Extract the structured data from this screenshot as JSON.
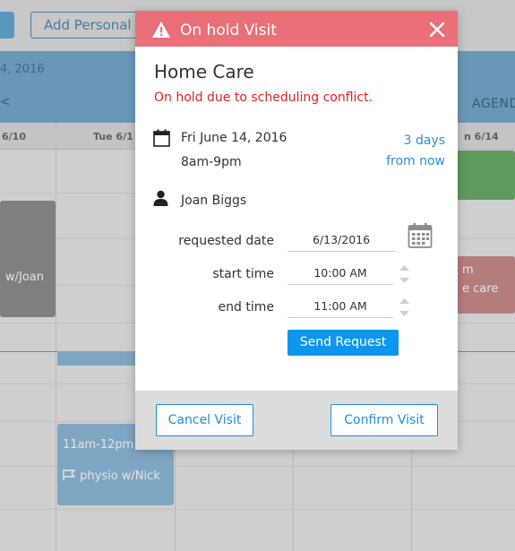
{
  "background": {
    "add_button_label": "Add Personal E",
    "date_label": "4, 2016",
    "nav_left": "<",
    "agenda_label": "AGEND",
    "days": [
      "6/10",
      "Tue 6/1",
      "n 6/14"
    ],
    "events": [
      {
        "text": "w/Joan"
      },
      {
        "line1": "m",
        "line2": "e care"
      },
      {
        "time": "11am-12pm",
        "title": "physio w/Nick"
      }
    ]
  },
  "modal": {
    "title": "On hold Visit",
    "service": "Home Care",
    "status_message": "On hold due to scheduling conflict.",
    "date": "Fri June 14, 2016",
    "time_range": "8am-9pm",
    "relative_line1": "3 days",
    "relative_line2": "from now",
    "person": "Joan Biggs",
    "requested_date_label": "requested date",
    "requested_date_value": "6/13/2016",
    "start_time_label": "start time",
    "start_time_value": "10:00 AM",
    "end_time_label": "end time",
    "end_time_value": "11:00 AM",
    "send_request_label": "Send Request",
    "cancel_label": "Cancel Visit",
    "confirm_label": "Confirm Visit"
  },
  "colors": {
    "header": "#ea6f78",
    "status_text": "#d9222a",
    "link": "#2a90d8",
    "primary_button": "#0e95ec",
    "footer": "#dcdcdc"
  },
  "icons": {
    "header": "warning-icon",
    "close": "close-icon",
    "date": "calendar-icon",
    "person": "person-icon",
    "picker": "calendar-picker-icon",
    "spinner": "spinner-arrows-icon"
  }
}
